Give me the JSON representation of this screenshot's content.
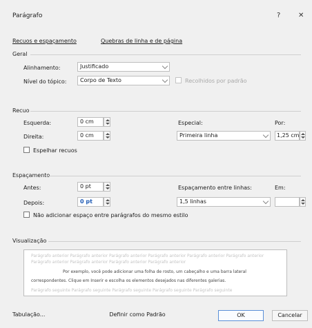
{
  "dialog": {
    "title": "Parágrafo",
    "help_label": "?",
    "close_label": "✕"
  },
  "tabs": [
    {
      "label": "Recuos e espaçamento",
      "active": true
    },
    {
      "label": "Quebras de linha e de página",
      "active": false
    }
  ],
  "geral": {
    "section_title": "Geral",
    "alinhamento_label": "Alinhamento:",
    "alinhamento_value": "Justificado",
    "nivel_label": "Nível do tópico:",
    "nivel_value": "Corpo de Texto",
    "recolhido_label": "Recolhidos por padrão"
  },
  "recuo": {
    "section_title": "Recuo",
    "esquerda_label": "Esquerda:",
    "esquerda_value": "0 cm",
    "direita_label": "Direita:",
    "direita_value": "0 cm",
    "especial_label": "Especial:",
    "especial_value": "Primeira linha",
    "por_label": "Por:",
    "por_value": "1,25 cm",
    "espelhar_label": "Espelhar recuos"
  },
  "espacamento": {
    "section_title": "Espaçamento",
    "antes_label": "Antes:",
    "antes_value": "0 pt",
    "depois_label": "Depois:",
    "depois_value": "0 pt",
    "entre_linhas_label": "Espaçamento entre linhas:",
    "entre_linhas_value": "1,5 linhas",
    "em_label": "Em:",
    "em_value": "",
    "nao_adicionar_label": "Não adicionar espaço entre parágrafos do mesmo estilo"
  },
  "visualizacao": {
    "section_title": "Visualização",
    "gray_line_1": "Parágrafo anterior Parágrafo anterior Parágrafo anterior Parágrafo anterior Parágrafo anterior Parágrafo anterior",
    "gray_line_2": "Parágrafo anterior Parágrafo anterior Parágrafo anterior Parágrafo anterior",
    "body_line_1": "Por exemplo, você pode adicionar uma folha de rosto, um cabeçalho e uma barra lateral",
    "body_line_2": "correspondentes. Clique em Inserir e escolha os elementos desejados nas diferentes galerias.",
    "gray_line_3": "Parágrafo seguinte Parágrafo seguinte Parágrafo seguinte Parágrafo seguinte Parágrafo seguinte"
  },
  "buttons": {
    "tabulacao": "Tabulação...",
    "definir_padrao": "Definir como Padrão",
    "ok": "OK",
    "cancelar": "Cancelar"
  }
}
